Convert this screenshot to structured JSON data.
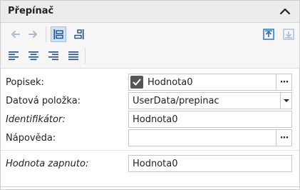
{
  "panel": {
    "title": "Přepínač"
  },
  "toolbar": {
    "buttons": [
      {
        "name": "arrow-left-icon",
        "enabled": false
      },
      {
        "name": "arrow-right-icon",
        "enabled": false
      },
      {
        "name": "label-left-layout-icon",
        "selected": true
      },
      {
        "name": "label-top-layout-icon",
        "selected": false
      },
      {
        "name": "move-up-icon",
        "enabled": true
      },
      {
        "name": "move-down-icon",
        "enabled": false
      },
      {
        "name": "align-left-icon"
      },
      {
        "name": "align-center-icon"
      },
      {
        "name": "align-right-icon"
      },
      {
        "name": "align-justify-icon"
      }
    ]
  },
  "properties": {
    "popisek": {
      "label": "Popisek:",
      "value": "Hodnota0",
      "checked": true,
      "more": "···"
    },
    "datova_polozka": {
      "label": "Datová položka:",
      "value": "UserData/prepinac"
    },
    "identifikator": {
      "label": "Identifikátor:",
      "value": "Hodnota0"
    },
    "napoveda": {
      "label": "Nápověda:",
      "value": "",
      "more": "···"
    },
    "hodnota_zapnuto": {
      "label": "Hodnota zapnuto:",
      "value": "Hodnota0"
    }
  },
  "colors": {
    "accent": "#1e6fc7",
    "disabled": "#a9bcd4"
  }
}
